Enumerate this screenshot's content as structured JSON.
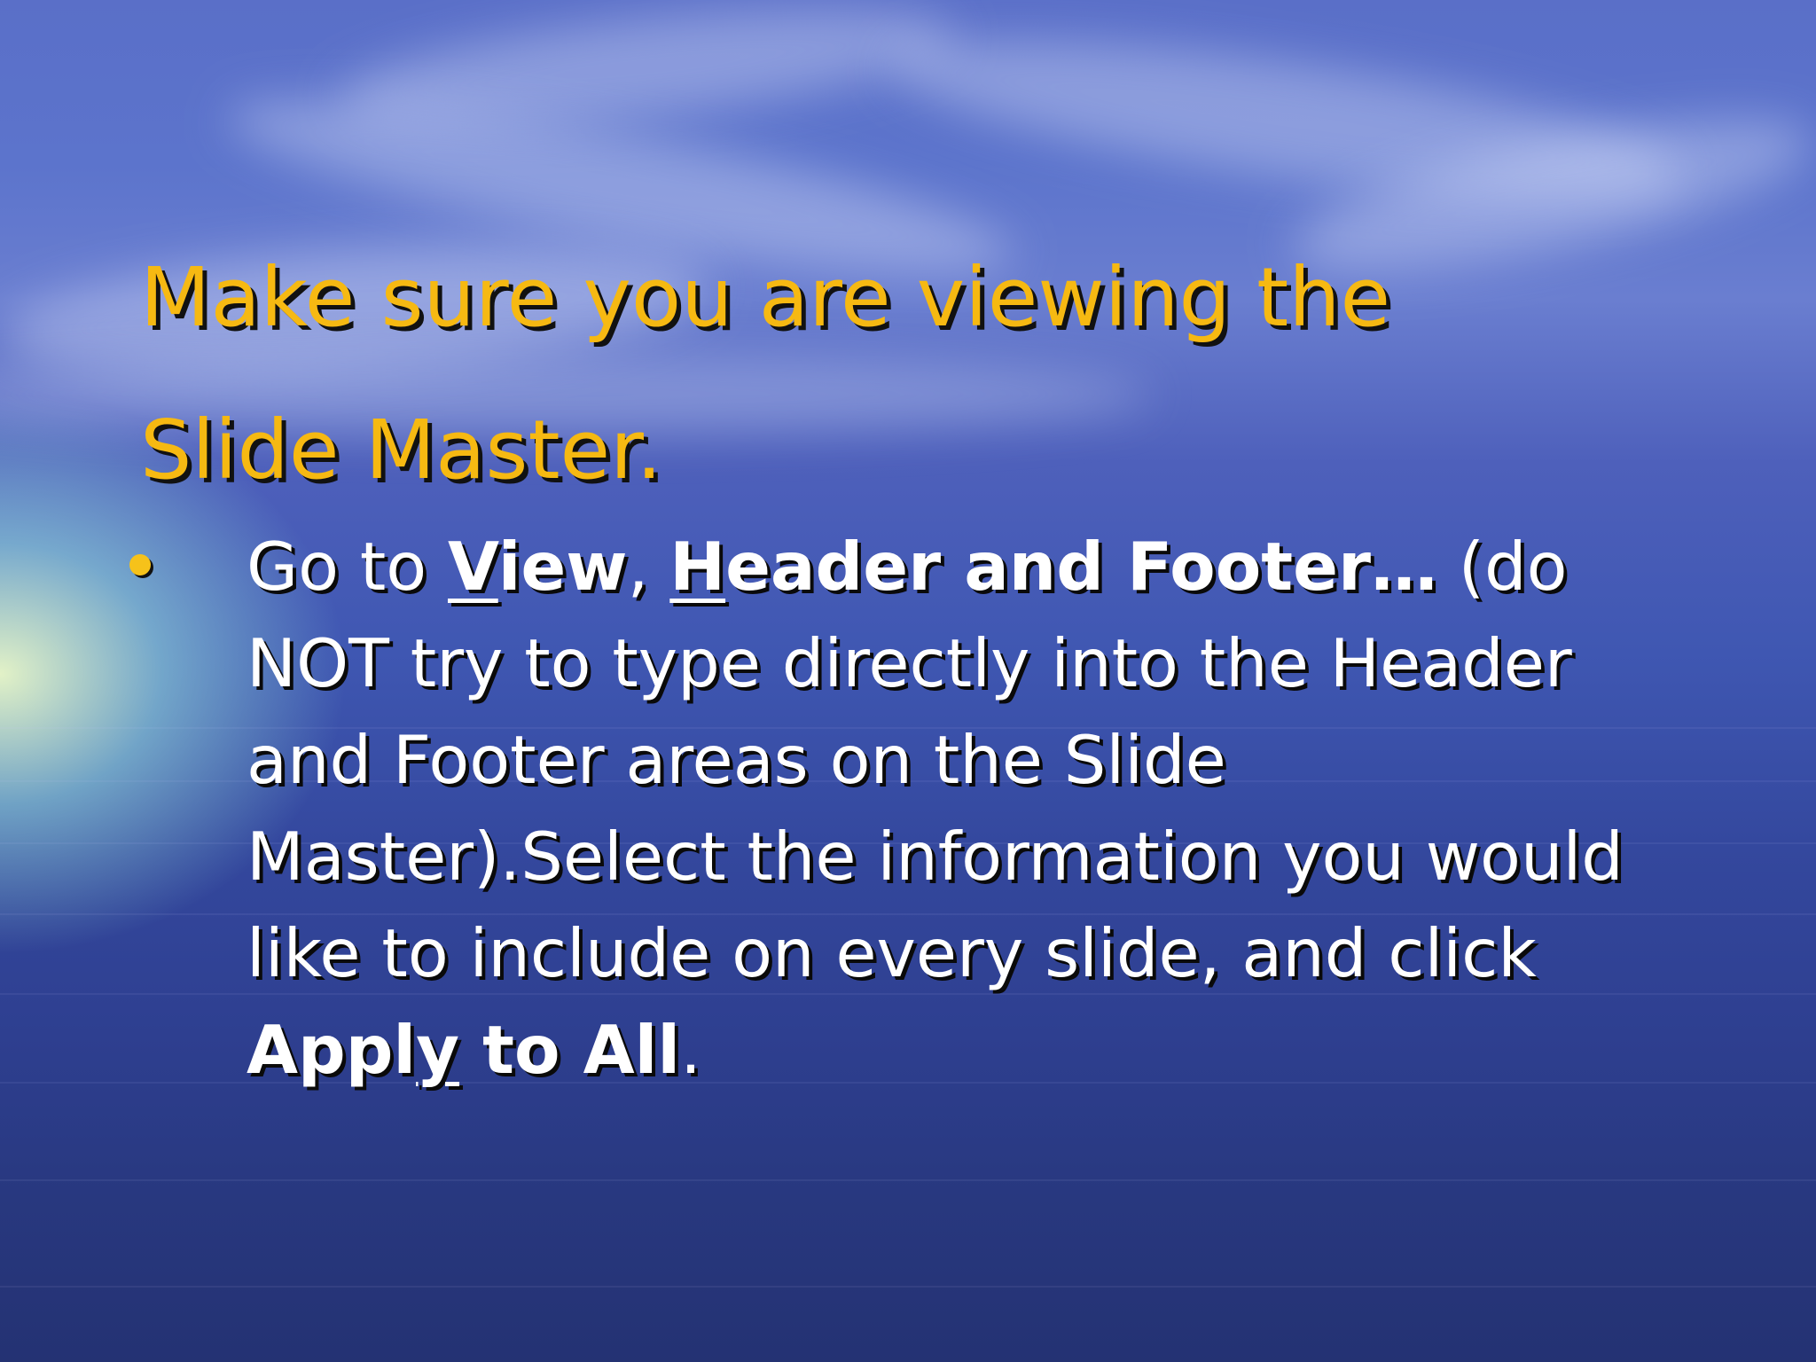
{
  "slide": {
    "title_lines": [
      "Make sure you are viewing the",
      "Slide Master."
    ],
    "bullet": {
      "line1": {
        "t1": "Go to ",
        "view_key": "V",
        "view_rest": "iew",
        "sep": ", ",
        "header_key": "H",
        "header_rest": "eader and Footer…",
        "t2": " (do"
      },
      "line2": "NOT try to type directly into the Header",
      "line3": "and Footer areas on the Slide",
      "line4": "Master).Select the information you would",
      "line5": "like to include on every slide, and click",
      "line6": {
        "apply_pre": "Appl",
        "apply_key": "y",
        "apply_post": " to All",
        "end": "."
      }
    }
  },
  "colors": {
    "title": "#f6b912",
    "body_text": "#ffffff",
    "bullet": "#f6c21a",
    "shadow": "#111111",
    "background_sky": "#5a6fc8",
    "background_sea": "#2e3f90"
  }
}
